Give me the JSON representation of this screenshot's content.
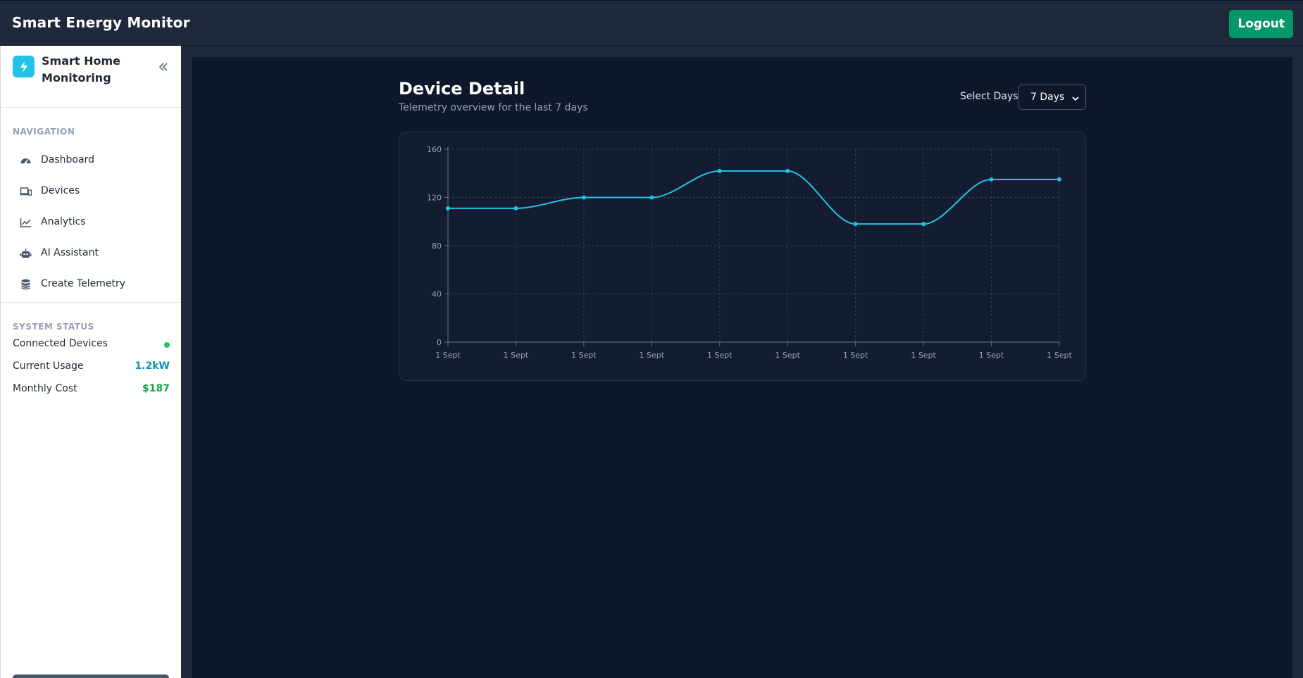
{
  "header": {
    "title": "Smart Energy Monitor",
    "logout_label": "Logout"
  },
  "sidebar": {
    "brand": "Smart Home Monitoring",
    "nav_title": "NAVIGATION",
    "items": [
      {
        "label": "Dashboard",
        "icon": "gauge-icon"
      },
      {
        "label": "Devices",
        "icon": "devices-icon"
      },
      {
        "label": "Analytics",
        "icon": "chart-line-icon"
      },
      {
        "label": "AI Assistant",
        "icon": "robot-icon"
      },
      {
        "label": "Create Telemetry",
        "icon": "database-icon"
      }
    ],
    "status_title": "SYSTEM STATUS",
    "status": [
      {
        "label": "Connected Devices",
        "value": "",
        "color": "#22c55e"
      },
      {
        "label": "Current Usage",
        "value": "1.2kW",
        "color": "#0891b2"
      },
      {
        "label": "Monthly Cost",
        "value": "$187",
        "color": "#16a34a"
      }
    ]
  },
  "main": {
    "title": "Device Detail",
    "subtitle": "Telemetry overview for the last 7 days",
    "select_label": "Select Days:",
    "select_value": "7 Days"
  },
  "chart_data": {
    "type": "line",
    "title": "",
    "xlabel": "",
    "ylabel": "",
    "categories": [
      "1 Sept",
      "1 Sept",
      "1 Sept",
      "1 Sept",
      "1 Sept",
      "1 Sept",
      "1 Sept",
      "1 Sept",
      "1 Sept",
      "1 Sept"
    ],
    "series": [
      {
        "values": [
          111,
          111,
          120,
          120,
          142,
          142,
          98,
          98,
          135,
          135
        ],
        "color": "#22c3e6"
      }
    ],
    "ylim": [
      0,
      160
    ],
    "yticks": [
      0,
      40,
      80,
      120,
      160
    ],
    "grid": true,
    "curve": "smooth"
  }
}
